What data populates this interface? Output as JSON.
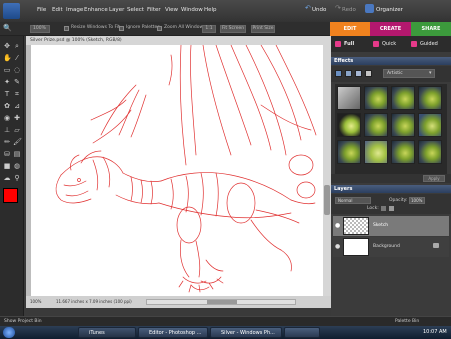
{
  "menubar": {
    "items": [
      "File",
      "Edit",
      "Image",
      "Enhance",
      "Layer",
      "Select",
      "Filter",
      "View",
      "Window",
      "Help"
    ],
    "undo": "Undo",
    "redo": "Redo",
    "organizer": "Organizer"
  },
  "options": {
    "zoom": "100%",
    "resize_windows": "Resize Windows To Fit",
    "ignore_palettes": "Ignore Palettes",
    "zoom_all": "Zoom All Windows",
    "one_to_one": "1:1",
    "fit_screen": "Fit Screen",
    "print_size": "Print Size"
  },
  "modes": {
    "edit": "EDIT",
    "create": "CREATE",
    "share": "SHARE"
  },
  "document": {
    "title": "Silver Prize.psd @ 100% (Sketch, RGB/8)",
    "status_zoom": "100%",
    "status_info": "11.667 inches x 7.09 inches (100 ppi)"
  },
  "rightpanel": {
    "full": "Full",
    "quick": "Quick",
    "guided": "Guided",
    "effects_title": "Effects",
    "effects_filter": "Artistic",
    "apply": "Apply",
    "layers_title": "Layers",
    "blend_mode": "Normal",
    "opacity_label": "Opacity:",
    "opacity_value": "100%",
    "lock_label": "Lock:",
    "layers": [
      {
        "name": "Sketch"
      },
      {
        "name": "Background"
      }
    ]
  },
  "bins": {
    "project_bin": "Show Project Bin",
    "palette_bin": "Palette Bin"
  },
  "taskbar": {
    "apps": [
      "iTunes",
      "Editor - Photoshop ...",
      "Silver - Windows Ph...",
      ""
    ],
    "time": "10:07 AM"
  },
  "colors": {
    "foreground": "#ff0000",
    "background": "#ffffff",
    "edit_tab": "#f0821e",
    "create_tab": "#b4186e",
    "share_tab": "#3c9a3c",
    "sketch_line": "#e03030"
  }
}
